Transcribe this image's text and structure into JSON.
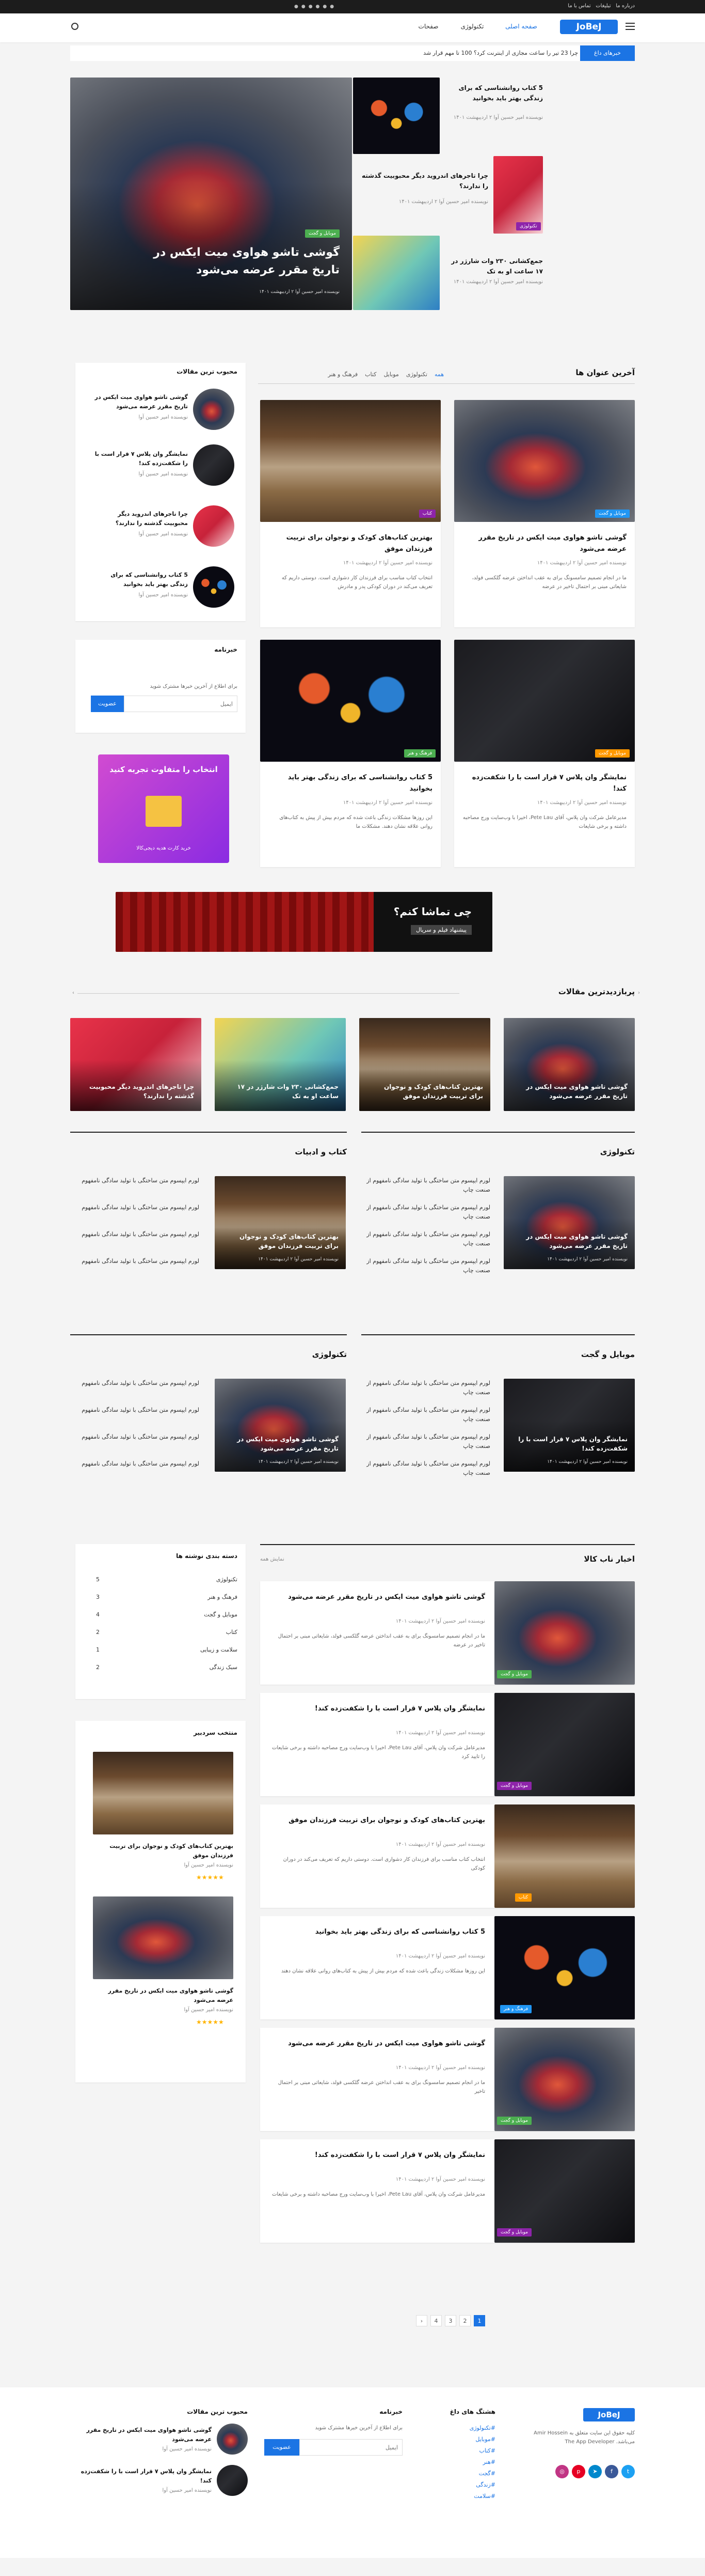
{
  "topbar": {
    "links": [
      "درباره ما",
      "تبلیغات",
      "تماس با ما"
    ],
    "date": "جمعه ۱۴ اردیبهشت ۱۴۰۱"
  },
  "header": {
    "logo": "JoBeJ",
    "nav": [
      "صفحه اصلی",
      "تکنولوژی",
      "صفحات"
    ]
  },
  "ticker": {
    "label": "خبرهای داغ",
    "text": "چرا 23 تیر را ساعت مجازی از اینترنت کرد؟ 100 تا مهم قرار شد"
  },
  "hero": {
    "main": {
      "title": "گوشی تاشو هواوی میت ایکس در تاریخ مقرر عرضه می‌شود",
      "badge": "موبایل و گجت",
      "meta": "نویسنده امیر حسین آوا  ۲ اردیبهشت ۱۴۰۱"
    },
    "side": [
      {
        "title": "5 کتاب روانشناسی که برای زندگی بهتر باید بخوانید",
        "meta": "نویسنده امیر حسین آوا  ۲ اردیبهشت ۱۴۰۱"
      },
      {
        "title": "چرا تاجرهای اندروید دیگر محبوبیت گذشته را ندارند؟",
        "badge": "تکنولوژی",
        "meta": "نویسنده امیر حسین آوا  ۲ اردیبهشت ۱۴۰۱"
      },
      {
        "title": "جمع‌کشانی ۲۳۰ وات شارژر در ۱۷ ساعت  او به تک",
        "meta": "نویسنده امیر حسین آوا  ۲ اردیبهشت ۱۴۰۱"
      }
    ]
  },
  "latest": {
    "heading": "آخرین عنوان ها",
    "tabs": [
      "همه",
      "تکنولوژی",
      "موبایل",
      "کتاب",
      "فرهنگ و هنر"
    ],
    "posts": [
      {
        "title": "گوشی تاشو هواوی میت ایکس در تاریخ مقرر عرضه می‌شود",
        "badge": "موبایل و گجت",
        "meta": "نویسنده امیر حسین آوا  ۲ اردیبهشت ۱۴۰۱",
        "excerpt": "ما در انجام تصمیم سامسونگ برای به عقب انداختن عرضه گلکسی فولد، شایعاتی مبنی بر احتمال تاخیر در عرضه"
      },
      {
        "title": "بهترین کتاب‌های کودک و نوجوان برای تربیت فرزندان موفق",
        "badge": "کتاب",
        "meta": "نویسنده امیر حسین آوا  ۲ اردیبهشت ۱۴۰۱",
        "excerpt": "انتخاب کتاب مناسب برای فرزندان کار دشواری است. دوستی داریم که تعریف می‌کند در دوران کودکی پدر و مادرش"
      },
      {
        "title": "نمایشگر وان پلاس ۷ قرار است با را شکفت‌زده کند!",
        "badge": "موبایل و گجت",
        "meta": "نویسنده امیر حسین آوا  ۲ اردیبهشت ۱۴۰۱",
        "excerpt": "مدیرعامل شرکت وان پلاس، آقای Pete Lau، اخیرا با وب‌سایت ورج مصاحبه داشته و برخی شایعات"
      },
      {
        "title": "5 کتاب روانشناسی که برای زندگی بهتر باید بخوانید",
        "badge": "فرهنگ و هنر",
        "meta": "نویسنده امیر حسین آوا  ۲ اردیبهشت ۱۴۰۱",
        "excerpt": "این روزها مشکلات زندگی باعث شده که مردم بیش از پیش به کتاب‌های روانی علاقه نشان دهند. مشکلات ما"
      }
    ]
  },
  "popular_side": {
    "heading": "محبوب ترین مقالات",
    "items": [
      {
        "title": "گوشی تاشو هواوی میت ایکس در تاریخ مقرر عرضه می‌شود",
        "meta": "نویسنده امیر حسین آوا"
      },
      {
        "title": "نمایشگر وان پلاس ۷ قرار است با را شکفت‌زده کند!",
        "meta": "نویسنده امیر حسین آوا"
      },
      {
        "title": "چرا تاجرهای اندروید دیگر محبوبیت گذشته را ندارند؟",
        "meta": "نویسنده امیر حسین آوا"
      },
      {
        "title": "5 کتاب روانشناسی که برای زندگی بهتر باید بخوانید",
        "meta": "نویسنده امیر حسین آوا"
      }
    ]
  },
  "newsletter": {
    "heading": "خبرنامه",
    "text": "برای اطلاع از آخرین خبرها مشترک شوید",
    "placeholder": "ایمیل",
    "button": "عضویت"
  },
  "ad": {
    "text": "انتخاب را متفاوت تجربه کنید",
    "sub": "خرید کارت هدیه دیجی‌کالا"
  },
  "banner": {
    "title": "چی تماشا کنم؟",
    "sub": "پیشنهاد فیلم و سریال"
  },
  "popular": {
    "heading": "پربازدیدترین مقالات",
    "items": [
      {
        "title": "گوشی تاشو هواوی میت ایکس در تاریخ مقرر عرضه می‌شود"
      },
      {
        "title": "بهترین کتاب‌های کودک و نوجوان برای تربیت فرزندان موفق"
      },
      {
        "title": "جمع‌کشانی ۲۳۰ وات شارژر در ۱۷ ساعت او به تک"
      },
      {
        "title": "چرا تاجرهای اندروید دیگر محبوبیت گذشته را ندارند؟"
      }
    ]
  },
  "sections": [
    {
      "heading": "تکنولوژی",
      "main": "گوشی تاشو هواوی میت ایکس در تاریخ مقرر عرضه می‌شود",
      "meta": "نویسنده امیر حسین آوا  ۲ اردیبهشت ۱۴۰۱",
      "list": [
        "لورم ایپسوم متن ساختگی با تولید سادگی نامفهوم از صنعت چاپ",
        "لورم ایپسوم متن ساختگی با تولید سادگی نامفهوم از صنعت چاپ",
        "لورم ایپسوم متن ساختگی با تولید سادگی نامفهوم از صنعت چاپ",
        "لورم ایپسوم متن ساختگی با تولید سادگی نامفهوم از صنعت چاپ"
      ]
    },
    {
      "heading": "کتاب و ادبیات",
      "main": "بهترین کتاب‌های کودک و نوجوان برای تربیت فرزندان موفق",
      "meta": "نویسنده امیر حسین آوا  ۲ اردیبهشت ۱۴۰۱",
      "list": [
        "لورم ایپسوم متن ساختگی با تولید سادگی نامفهوم",
        "لورم ایپسوم متن ساختگی با تولید سادگی نامفهوم",
        "لورم ایپسوم متن ساختگی با تولید سادگی نامفهوم",
        "لورم ایپسوم متن ساختگی با تولید سادگی نامفهوم"
      ]
    },
    {
      "heading": "موبایل و گجت",
      "main": "نمایشگر وان پلاس ۷ قرار است با را شکفت‌زده کند!",
      "meta": "نویسنده امیر حسین آوا  ۲ اردیبهشت ۱۴۰۱",
      "list": [
        "لورم ایپسوم متن ساختگی با تولید سادگی نامفهوم از صنعت چاپ",
        "لورم ایپسوم متن ساختگی با تولید سادگی نامفهوم از صنعت چاپ",
        "لورم ایپسوم متن ساختگی با تولید سادگی نامفهوم از صنعت چاپ",
        "لورم ایپسوم متن ساختگی با تولید سادگی نامفهوم از صنعت چاپ"
      ]
    },
    {
      "heading": "تکنولوژی",
      "main": "گوشی تاشو هواوی میت ایکس در تاریخ مقرر عرضه می‌شود",
      "meta": "نویسنده امیر حسین آوا  ۲ اردیبهشت ۱۴۰۱",
      "list": [
        "لورم ایپسوم متن ساختگی با تولید سادگی نامفهوم",
        "لورم ایپسوم متن ساختگی با تولید سادگی نامفهوم",
        "لورم ایپسوم متن ساختگی با تولید سادگی نامفهوم",
        "لورم ایپسوم متن ساختگی با تولید سادگی نامفهوم"
      ]
    }
  ],
  "news": {
    "heading": "اخبار ناب کالا",
    "crumb": "نمایش همه",
    "items": [
      {
        "title": "گوشی تاشو هواوی میت ایکس در تاریخ مقرر عرضه می‌شود",
        "badge": "موبایل و گجت",
        "meta": "نویسنده امیر حسین آوا  ۲ اردیبهشت ۱۴۰۱",
        "excerpt": "ما در انجام تصمیم سامسونگ برای به عقب انداختن عرضه گلکسی فولد، شایعاتی مبنی بر احتمال تاخیر در عرضه"
      },
      {
        "title": "نمایشگر وان پلاس ۷ قرار است با را شکفت‌زده کند!",
        "badge": "موبایل و گجت",
        "meta": "نویسنده امیر حسین آوا  ۲ اردیبهشت ۱۴۰۱",
        "excerpt": "مدیرعامل شرکت وان پلاس، آقای Pete Lau، اخیرا با وب‌سایت ورج مصاحبه داشته و برخی شایعات را تایید کرد"
      },
      {
        "title": "بهترین کتاب‌های کودک و نوجوان برای تربیت فرزندان موفق",
        "badge": "کتاب",
        "meta": "نویسنده امیر حسین آوا  ۲ اردیبهشت ۱۴۰۱",
        "excerpt": "انتخاب کتاب مناسب برای فرزندان کار دشواری است. دوستی داریم که تعریف می‌کند در دوران کودکی"
      },
      {
        "title": "5 کتاب روانشناسی که برای زندگی بهتر باید بخوانید",
        "badge": "فرهنگ و هنر",
        "meta": "نویسنده امیر حسین آوا  ۲ اردیبهشت ۱۴۰۱",
        "excerpt": "این روزها مشکلات زندگی باعث شده که مردم بیش از پیش به کتاب‌های روانی علاقه نشان دهند"
      },
      {
        "title": "گوشی تاشو هواوی میت ایکس در تاریخ مقرر عرضه می‌شود",
        "badge": "موبایل و گجت",
        "meta": "نویسنده امیر حسین آوا  ۲ اردیبهشت ۱۴۰۱",
        "excerpt": "ما در انجام تصمیم سامسونگ برای به عقب انداختن عرضه گلکسی فولد، شایعاتی مبنی بر احتمال تاخیر"
      },
      {
        "title": "نمایشگر وان پلاس ۷ قرار است با را شکفت‌زده کند!",
        "badge": "موبایل و گجت",
        "meta": "نویسنده امیر حسین آوا  ۲ اردیبهشت ۱۴۰۱",
        "excerpt": "مدیرعامل شرکت وان پلاس، آقای Pete Lau، اخیرا با وب‌سایت ورج مصاحبه داشته و برخی شایعات"
      }
    ]
  },
  "categories": {
    "heading": "دسته بندی نوشته ها",
    "items": [
      {
        "name": "تکنولوژی",
        "count": "5"
      },
      {
        "name": "فرهنگ و هنر",
        "count": "3"
      },
      {
        "name": "موبایل و گجت",
        "count": "4"
      },
      {
        "name": "کتاب",
        "count": "2"
      },
      {
        "name": "سلامت و زیبایی",
        "count": "1"
      },
      {
        "name": "سبک زندگی",
        "count": "2"
      }
    ]
  },
  "editors": {
    "heading": "منتخب سردبیر",
    "items": [
      {
        "title": "بهترین کتاب‌های کودک و نوجوان برای تربیت فرزندان موفق",
        "meta": "نویسنده امیر حسین آوا"
      },
      {
        "title": "گوشی تاشو هواوی میت ایکس در تاریخ مقرر عرضه می‌شود",
        "meta": "نویسنده امیر حسین آوا"
      }
    ]
  },
  "pagination": [
    "1",
    "2",
    "3",
    "4",
    "›"
  ],
  "footer": {
    "about": "کلیه حقوق این سایت متعلق به Amir Hossein می‌باشد. The App Developer",
    "tags_heading": "هشتگ های داغ",
    "tags": [
      "#تکنولوژی",
      "#موبایل",
      "#کتاب",
      "#هنر",
      "#گجت",
      "#زندگی",
      "#سلامت"
    ],
    "newsletter_heading": "خبرنامه",
    "newsletter_text": "برای اطلاع از آخرین خبرها مشترک شوید",
    "popular_heading": "محبوب ترین مقالات",
    "popular": [
      {
        "title": "گوشی تاشو هواوی میت ایکس در تاریخ مقرر عرضه می‌شود",
        "meta": "نویسنده امیر حسین آوا"
      },
      {
        "title": "نمایشگر وان پلاس ۷ قرار است با را شکفت‌زده کند!",
        "meta": "نویسنده امیر حسین آوا"
      }
    ]
  }
}
